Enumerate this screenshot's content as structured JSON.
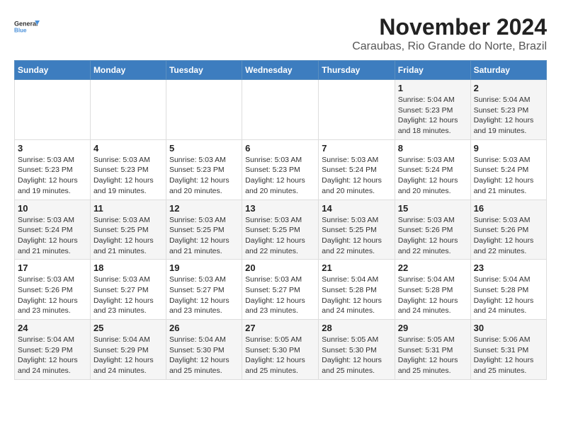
{
  "logo": {
    "line1": "General",
    "line2": "Blue"
  },
  "title": "November 2024",
  "location": "Caraubas, Rio Grande do Norte, Brazil",
  "weekdays": [
    "Sunday",
    "Monday",
    "Tuesday",
    "Wednesday",
    "Thursday",
    "Friday",
    "Saturday"
  ],
  "weeks": [
    [
      {
        "day": "",
        "info": ""
      },
      {
        "day": "",
        "info": ""
      },
      {
        "day": "",
        "info": ""
      },
      {
        "day": "",
        "info": ""
      },
      {
        "day": "",
        "info": ""
      },
      {
        "day": "1",
        "info": "Sunrise: 5:04 AM\nSunset: 5:23 PM\nDaylight: 12 hours\nand 18 minutes."
      },
      {
        "day": "2",
        "info": "Sunrise: 5:04 AM\nSunset: 5:23 PM\nDaylight: 12 hours\nand 19 minutes."
      }
    ],
    [
      {
        "day": "3",
        "info": "Sunrise: 5:03 AM\nSunset: 5:23 PM\nDaylight: 12 hours\nand 19 minutes."
      },
      {
        "day": "4",
        "info": "Sunrise: 5:03 AM\nSunset: 5:23 PM\nDaylight: 12 hours\nand 19 minutes."
      },
      {
        "day": "5",
        "info": "Sunrise: 5:03 AM\nSunset: 5:23 PM\nDaylight: 12 hours\nand 20 minutes."
      },
      {
        "day": "6",
        "info": "Sunrise: 5:03 AM\nSunset: 5:23 PM\nDaylight: 12 hours\nand 20 minutes."
      },
      {
        "day": "7",
        "info": "Sunrise: 5:03 AM\nSunset: 5:24 PM\nDaylight: 12 hours\nand 20 minutes."
      },
      {
        "day": "8",
        "info": "Sunrise: 5:03 AM\nSunset: 5:24 PM\nDaylight: 12 hours\nand 20 minutes."
      },
      {
        "day": "9",
        "info": "Sunrise: 5:03 AM\nSunset: 5:24 PM\nDaylight: 12 hours\nand 21 minutes."
      }
    ],
    [
      {
        "day": "10",
        "info": "Sunrise: 5:03 AM\nSunset: 5:24 PM\nDaylight: 12 hours\nand 21 minutes."
      },
      {
        "day": "11",
        "info": "Sunrise: 5:03 AM\nSunset: 5:25 PM\nDaylight: 12 hours\nand 21 minutes."
      },
      {
        "day": "12",
        "info": "Sunrise: 5:03 AM\nSunset: 5:25 PM\nDaylight: 12 hours\nand 21 minutes."
      },
      {
        "day": "13",
        "info": "Sunrise: 5:03 AM\nSunset: 5:25 PM\nDaylight: 12 hours\nand 22 minutes."
      },
      {
        "day": "14",
        "info": "Sunrise: 5:03 AM\nSunset: 5:25 PM\nDaylight: 12 hours\nand 22 minutes."
      },
      {
        "day": "15",
        "info": "Sunrise: 5:03 AM\nSunset: 5:26 PM\nDaylight: 12 hours\nand 22 minutes."
      },
      {
        "day": "16",
        "info": "Sunrise: 5:03 AM\nSunset: 5:26 PM\nDaylight: 12 hours\nand 22 minutes."
      }
    ],
    [
      {
        "day": "17",
        "info": "Sunrise: 5:03 AM\nSunset: 5:26 PM\nDaylight: 12 hours\nand 23 minutes."
      },
      {
        "day": "18",
        "info": "Sunrise: 5:03 AM\nSunset: 5:27 PM\nDaylight: 12 hours\nand 23 minutes."
      },
      {
        "day": "19",
        "info": "Sunrise: 5:03 AM\nSunset: 5:27 PM\nDaylight: 12 hours\nand 23 minutes."
      },
      {
        "day": "20",
        "info": "Sunrise: 5:03 AM\nSunset: 5:27 PM\nDaylight: 12 hours\nand 23 minutes."
      },
      {
        "day": "21",
        "info": "Sunrise: 5:04 AM\nSunset: 5:28 PM\nDaylight: 12 hours\nand 24 minutes."
      },
      {
        "day": "22",
        "info": "Sunrise: 5:04 AM\nSunset: 5:28 PM\nDaylight: 12 hours\nand 24 minutes."
      },
      {
        "day": "23",
        "info": "Sunrise: 5:04 AM\nSunset: 5:28 PM\nDaylight: 12 hours\nand 24 minutes."
      }
    ],
    [
      {
        "day": "24",
        "info": "Sunrise: 5:04 AM\nSunset: 5:29 PM\nDaylight: 12 hours\nand 24 minutes."
      },
      {
        "day": "25",
        "info": "Sunrise: 5:04 AM\nSunset: 5:29 PM\nDaylight: 12 hours\nand 24 minutes."
      },
      {
        "day": "26",
        "info": "Sunrise: 5:04 AM\nSunset: 5:30 PM\nDaylight: 12 hours\nand 25 minutes."
      },
      {
        "day": "27",
        "info": "Sunrise: 5:05 AM\nSunset: 5:30 PM\nDaylight: 12 hours\nand 25 minutes."
      },
      {
        "day": "28",
        "info": "Sunrise: 5:05 AM\nSunset: 5:30 PM\nDaylight: 12 hours\nand 25 minutes."
      },
      {
        "day": "29",
        "info": "Sunrise: 5:05 AM\nSunset: 5:31 PM\nDaylight: 12 hours\nand 25 minutes."
      },
      {
        "day": "30",
        "info": "Sunrise: 5:06 AM\nSunset: 5:31 PM\nDaylight: 12 hours\nand 25 minutes."
      }
    ]
  ]
}
